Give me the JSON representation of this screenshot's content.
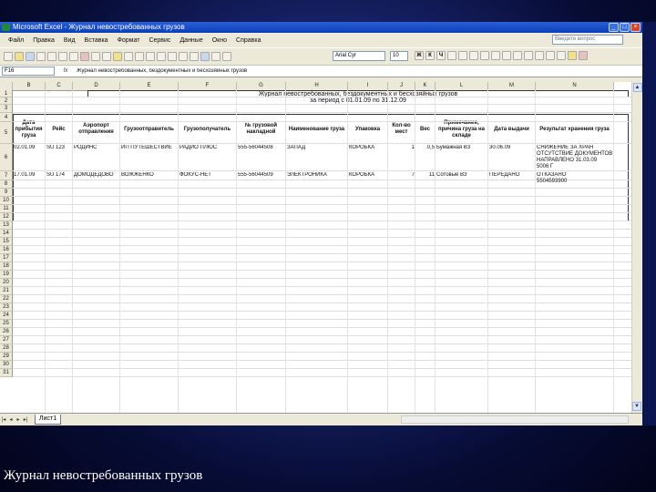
{
  "window": {
    "title": "Microsoft Excel - Журнал невостребованных грузов"
  },
  "menu": [
    "Файл",
    "Правка",
    "Вид",
    "Вставка",
    "Формат",
    "Сервис",
    "Данные",
    "Окно",
    "Справка"
  ],
  "help_placeholder": "Введите вопрос",
  "font": {
    "name": "Arial Cyr",
    "size": "10"
  },
  "format_buttons": {
    "bold": "Ж",
    "italic": "К",
    "underline": "Ч"
  },
  "formula_bar": {
    "name_box": "F16",
    "fx": "fx",
    "formula": "Журнал невостребованных, бездокументных и бесхозяйных грузов"
  },
  "columns": [
    "B",
    "C",
    "D",
    "E",
    "F",
    "G",
    "H",
    "I",
    "J",
    "K",
    "L",
    "M",
    "N"
  ],
  "rows": [
    "1",
    "2",
    "3",
    "4",
    "5",
    "6",
    "7",
    "8",
    "9",
    "10",
    "11",
    "12",
    "13",
    "14",
    "15",
    "16",
    "17",
    "18",
    "19",
    "20",
    "21",
    "22",
    "23",
    "24",
    "25",
    "26",
    "27",
    "28",
    "29",
    "30",
    "31"
  ],
  "sheet": {
    "title": "Журнал невостребованных, бездокументных и бесхозяйных грузов",
    "period": "за период с 01.01.09 по 31.12.09",
    "headers": [
      "Дата прибытия груза",
      "Рейс",
      "Аэропорт отправления",
      "Грузоотправитель",
      "Грузополучатель",
      "№ грузовой накладной",
      "Наименование груза",
      "Упаковка",
      "Кол-во мест",
      "Вес",
      "Примечание, причина груза на складе",
      "Дата выдачи",
      "Результат хранения груза"
    ],
    "data_rows": [
      [
        "02.01.09",
        "SU 123",
        "РОДИНС",
        "ИП ПУТЕШЕСТВИЕ",
        "РАДИО ПЛЮС",
        "555-56044508",
        "ЗАПАД",
        "КОРОБКА",
        "1",
        "0,5",
        "Бумажная ВЗ",
        "30.06.09",
        "СНИЖЕНИЕ ЗА ХРАН\nОТСУТСТВИЕ ДОКУМЕНТОВ\nНАПРАВЛЕНО 31.03.09\n5006 Г"
      ],
      [
        "17.01.09",
        "SU 174",
        "ДОМОДЕДОВО",
        "ВОЖЖЕНКО",
        "ФОКУС-НЕТ",
        "555-56044509",
        "ЭЛЕКТРОНИКА",
        "КОРОБКА",
        "7",
        "11",
        "Сотовые ВЗ",
        "ПЕРЕДАНО",
        "ОТКАЗАНО\n5504593900"
      ]
    ]
  },
  "sheet_tab": "Лист1",
  "slide_caption": "Журнал невостребованных грузов"
}
